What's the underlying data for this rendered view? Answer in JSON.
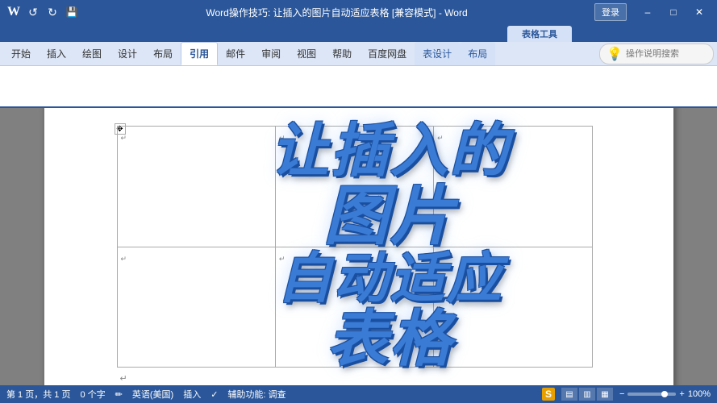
{
  "titlebar": {
    "title": "Word操作技巧: 让插入的图片自动适应表格 [兼容模式] - Word",
    "login": "登录",
    "undo": "↺",
    "redo": "↻",
    "save": "💾"
  },
  "context_tab": {
    "label": "表格工具"
  },
  "ribbon_tabs": [
    {
      "label": "开始",
      "active": false
    },
    {
      "label": "插入",
      "active": false
    },
    {
      "label": "绘图",
      "active": false
    },
    {
      "label": "设计",
      "active": false
    },
    {
      "label": "布局",
      "active": false
    },
    {
      "label": "引用",
      "active": true
    },
    {
      "label": "邮件",
      "active": false
    },
    {
      "label": "审阅",
      "active": false
    },
    {
      "label": "视图",
      "active": false
    },
    {
      "label": "帮助",
      "active": false
    },
    {
      "label": "百度网盘",
      "active": false
    },
    {
      "label": "表设计",
      "active": false
    },
    {
      "label": "布局",
      "active": false
    }
  ],
  "ribbon_search": {
    "placeholder": "操作说明搜索",
    "icon": "💡"
  },
  "big_text": {
    "line1": "让插入的",
    "line2": "图片",
    "line3": "自动适应",
    "line4": "表格"
  },
  "statusbar": {
    "pages": "第 1 页，共 1 页",
    "words": "0 个字",
    "lang": "英语(美国)",
    "insert": "插入",
    "assist": "辅助功能: 调查",
    "zoom": "100%"
  }
}
